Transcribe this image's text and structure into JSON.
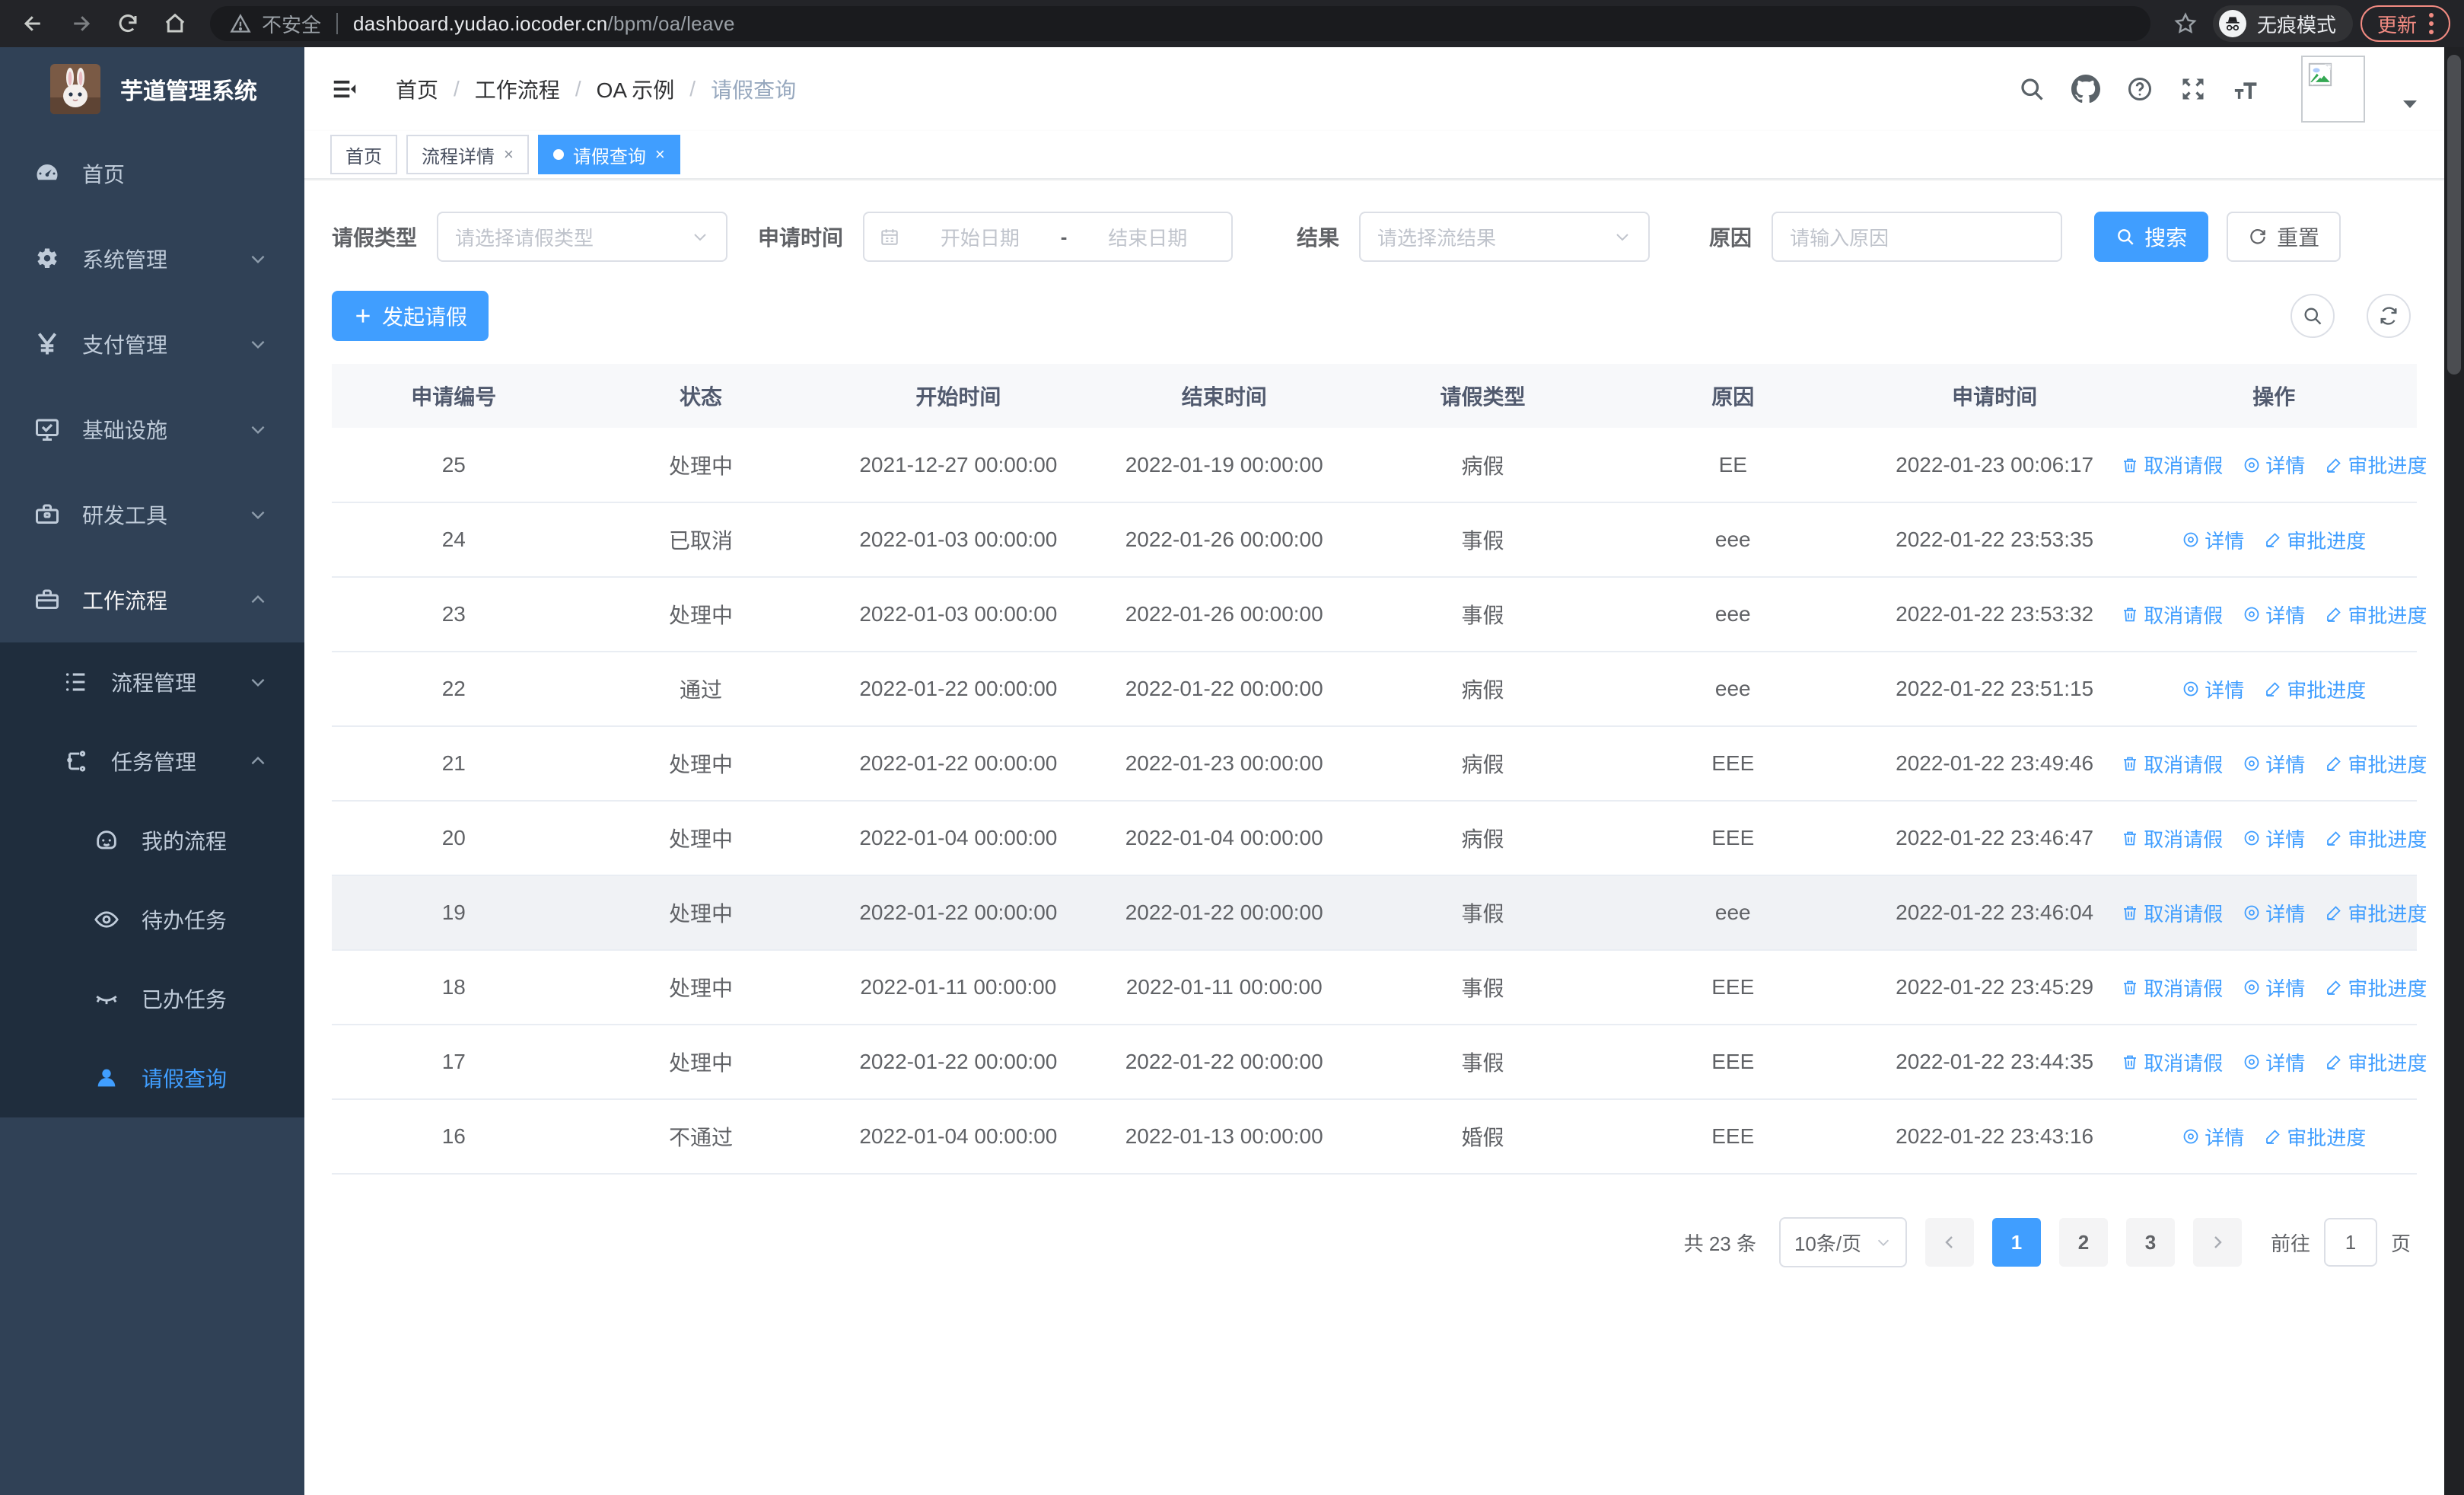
{
  "browser": {
    "security_label": "不安全",
    "url_domain": "dashboard.yudao.iocoder.cn",
    "url_path": "/bpm/oa/leave",
    "incognito_label": "无痕模式",
    "update_label": "更新"
  },
  "sidebar": {
    "app_title": "芋道管理系统",
    "items": [
      {
        "label": "首页"
      },
      {
        "label": "系统管理"
      },
      {
        "label": "支付管理"
      },
      {
        "label": "基础设施"
      },
      {
        "label": "研发工具"
      },
      {
        "label": "工作流程"
      }
    ],
    "submenu": [
      {
        "label": "流程管理"
      },
      {
        "label": "任务管理"
      },
      {
        "label": "我的流程"
      },
      {
        "label": "待办任务"
      },
      {
        "label": "已办任务"
      },
      {
        "label": "请假查询"
      }
    ]
  },
  "navbar": {
    "breadcrumb": [
      "首页",
      "工作流程",
      "OA 示例",
      "请假查询"
    ]
  },
  "tabs": [
    {
      "label": "首页"
    },
    {
      "label": "流程详情"
    },
    {
      "label": "请假查询"
    }
  ],
  "filters": {
    "leave_type_label": "请假类型",
    "leave_type_placeholder": "请选择请假类型",
    "apply_time_label": "申请时间",
    "date_start_placeholder": "开始日期",
    "date_separator": "-",
    "date_end_placeholder": "结束日期",
    "result_label": "结果",
    "result_placeholder": "请选择流结果",
    "reason_label": "原因",
    "reason_placeholder": "请输入原因",
    "search_label": "搜索",
    "reset_label": "重置"
  },
  "toolbar": {
    "create_label": "发起请假"
  },
  "table": {
    "columns": [
      "申请编号",
      "状态",
      "开始时间",
      "结束时间",
      "请假类型",
      "原因",
      "申请时间",
      "操作"
    ],
    "action_labels": {
      "cancel": "取消请假",
      "detail": "详情",
      "progress": "审批进度"
    },
    "rows": [
      {
        "id": "25",
        "status": "处理中",
        "start": "2021-12-27 00:00:00",
        "end": "2022-01-19 00:00:00",
        "type": "病假",
        "reason": "EE",
        "applied": "2022-01-23 00:06:17",
        "cancellable": true,
        "highlight": false
      },
      {
        "id": "24",
        "status": "已取消",
        "start": "2022-01-03 00:00:00",
        "end": "2022-01-26 00:00:00",
        "type": "事假",
        "reason": "eee",
        "applied": "2022-01-22 23:53:35",
        "cancellable": false,
        "highlight": false
      },
      {
        "id": "23",
        "status": "处理中",
        "start": "2022-01-03 00:00:00",
        "end": "2022-01-26 00:00:00",
        "type": "事假",
        "reason": "eee",
        "applied": "2022-01-22 23:53:32",
        "cancellable": true,
        "highlight": false
      },
      {
        "id": "22",
        "status": "通过",
        "start": "2022-01-22 00:00:00",
        "end": "2022-01-22 00:00:00",
        "type": "病假",
        "reason": "eee",
        "applied": "2022-01-22 23:51:15",
        "cancellable": false,
        "highlight": false
      },
      {
        "id": "21",
        "status": "处理中",
        "start": "2022-01-22 00:00:00",
        "end": "2022-01-23 00:00:00",
        "type": "病假",
        "reason": "EEE",
        "applied": "2022-01-22 23:49:46",
        "cancellable": true,
        "highlight": false
      },
      {
        "id": "20",
        "status": "处理中",
        "start": "2022-01-04 00:00:00",
        "end": "2022-01-04 00:00:00",
        "type": "病假",
        "reason": "EEE",
        "applied": "2022-01-22 23:46:47",
        "cancellable": true,
        "highlight": false
      },
      {
        "id": "19",
        "status": "处理中",
        "start": "2022-01-22 00:00:00",
        "end": "2022-01-22 00:00:00",
        "type": "事假",
        "reason": "eee",
        "applied": "2022-01-22 23:46:04",
        "cancellable": true,
        "highlight": true
      },
      {
        "id": "18",
        "status": "处理中",
        "start": "2022-01-11 00:00:00",
        "end": "2022-01-11 00:00:00",
        "type": "事假",
        "reason": "EEE",
        "applied": "2022-01-22 23:45:29",
        "cancellable": true,
        "highlight": false
      },
      {
        "id": "17",
        "status": "处理中",
        "start": "2022-01-22 00:00:00",
        "end": "2022-01-22 00:00:00",
        "type": "事假",
        "reason": "EEE",
        "applied": "2022-01-22 23:44:35",
        "cancellable": true,
        "highlight": false
      },
      {
        "id": "16",
        "status": "不通过",
        "start": "2022-01-04 00:00:00",
        "end": "2022-01-13 00:00:00",
        "type": "婚假",
        "reason": "EEE",
        "applied": "2022-01-22 23:43:16",
        "cancellable": false,
        "highlight": false
      }
    ]
  },
  "pagination": {
    "total_label": "共 23 条",
    "page_size_label": "10条/页",
    "pages": [
      "1",
      "2",
      "3"
    ],
    "active_page": "1",
    "goto_label": "前往",
    "goto_value": "1",
    "page_unit": "页"
  },
  "colors": {
    "accent": "#409eff",
    "sidebar_bg": "#304156",
    "submenu_bg": "#1f2d3d",
    "update_red": "#f28b82"
  }
}
